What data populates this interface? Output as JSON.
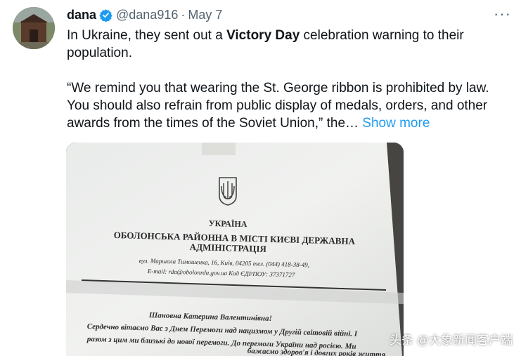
{
  "tweet": {
    "display_name": "dana",
    "handle": "@dana916",
    "separator": "·",
    "date": "May 7",
    "more_icon": "···",
    "text_before": "In Ukraine, they sent out a ",
    "text_bold": "Victory Day",
    "text_after": " celebration warning to their population.",
    "quote": "“We remind you that wearing the St. George ribbon is prohibited by law. You should also refrain from public display of medals, orders, and other awards from the times of the Soviet Union,” the…",
    "show_more": "Show more"
  },
  "document": {
    "country": "УКРАЇНА",
    "org_line1": "ОБОЛОНСЬКА РАЙОННА В МІСТІ КИЄВІ ДЕРЖАВНА",
    "org_line2": "АДМІНІСТРАЦІЯ",
    "address": "вул. Маршала Тимошенка, 16, Київ, 04205  тел. (044) 418-38-49,",
    "email": "E-mail: rda@obolonrda.gov.ua  Код ЄДРПОУ:  37371727",
    "greeting": "Шановна Катерина Валентинівна!",
    "line1": "Сердечно вітаємо Вас з Днем Перемоги над нацизмом у Другій світовій війні. І",
    "line2": "разом з цим ми близькі до нової перемоги. До перемоги України над росією. Ми",
    "line3": "бажаємо здоров'я і довгих років життя"
  },
  "watermark": "头条 @大象新闻客户端",
  "colors": {
    "link": "#1d9bf0",
    "verified": "#1d9bf0",
    "muted": "#536471"
  },
  "icons": {
    "verified": "verified-badge-icon",
    "more": "more-options-icon",
    "trident": "coat-of-arms-icon"
  }
}
